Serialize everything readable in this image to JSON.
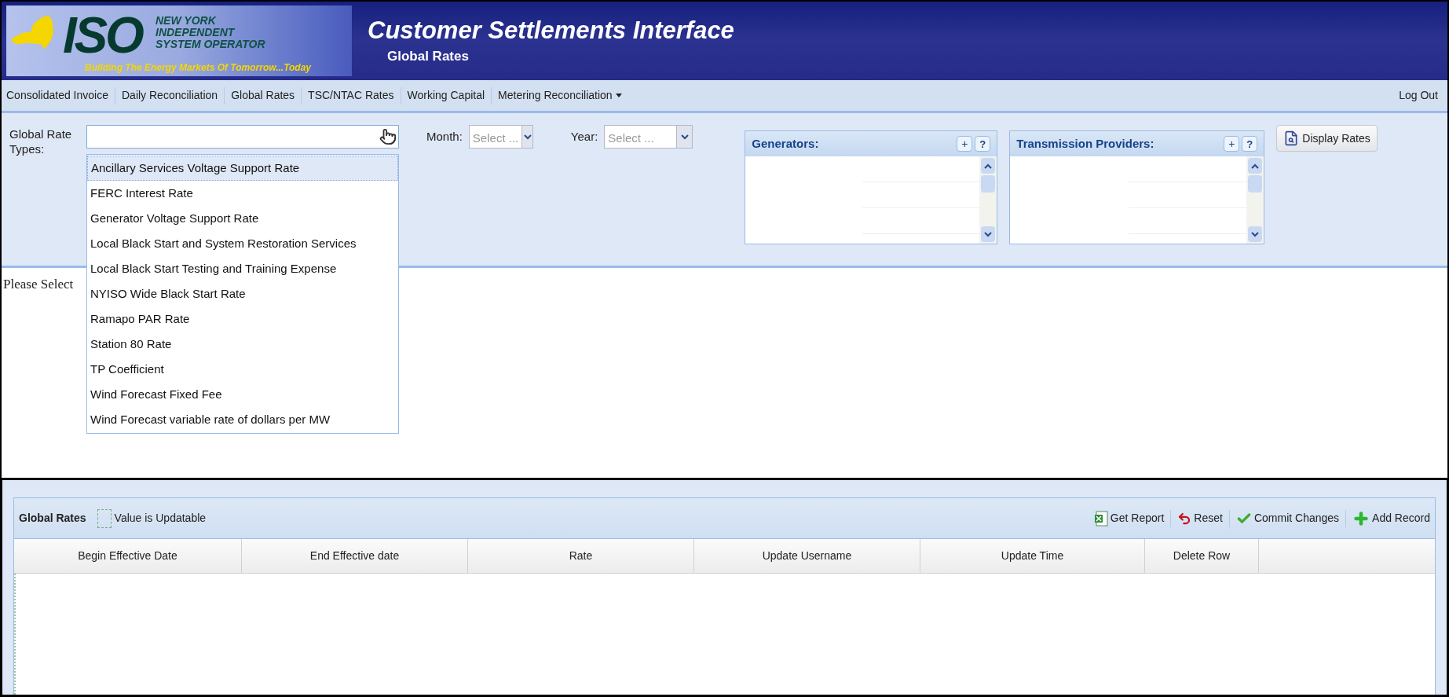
{
  "logo": {
    "mark": "ISO",
    "lines": [
      "NEW YORK",
      "INDEPENDENT",
      "SYSTEM OPERATOR"
    ],
    "tagline": "Building The Energy Markets Of Tomorrow...Today"
  },
  "header": {
    "title": "Customer Settlements Interface",
    "subtitle": "Global Rates"
  },
  "nav": {
    "items": [
      {
        "label": "Consolidated Invoice",
        "has_menu": false
      },
      {
        "label": "Daily Reconciliation",
        "has_menu": false
      },
      {
        "label": "Global Rates",
        "has_menu": false
      },
      {
        "label": "TSC/NTAC Rates",
        "has_menu": false
      },
      {
        "label": "Working Capital",
        "has_menu": false
      },
      {
        "label": "Metering Reconciliation",
        "has_menu": true
      }
    ],
    "logout": "Log Out"
  },
  "filters": {
    "rate_types": {
      "label": "Global Rate Types:",
      "expanded": true,
      "options": [
        {
          "label": "Ancillary Services Voltage Support Rate",
          "selected": true
        },
        {
          "label": "FERC Interest Rate",
          "selected": false
        },
        {
          "label": "Generator Voltage Support Rate",
          "selected": false
        },
        {
          "label": "Local Black Start and System Restoration Services",
          "selected": false
        },
        {
          "label": "Local Black Start Testing and Training Expense",
          "selected": false
        },
        {
          "label": "NYISO Wide Black Start Rate",
          "selected": false
        },
        {
          "label": "Ramapo PAR Rate",
          "selected": false
        },
        {
          "label": "Station 80 Rate",
          "selected": false
        },
        {
          "label": "TP Coefficient",
          "selected": false
        },
        {
          "label": "Wind Forecast Fixed Fee",
          "selected": false
        },
        {
          "label": "Wind Forecast variable rate of dollars per MW",
          "selected": false
        }
      ]
    },
    "month": {
      "label": "Month:",
      "placeholder": "Select ..."
    },
    "year": {
      "label": "Year:",
      "placeholder": "Select ..."
    }
  },
  "lists": [
    {
      "title": "Generators:",
      "add": "+",
      "help": "?"
    },
    {
      "title": "Transmission Providers:",
      "add": "+",
      "help": "?"
    }
  ],
  "display_button": "Display Rates",
  "message": "Please Select",
  "grid": {
    "title": "Global Rates",
    "legend": "Value is Updatable",
    "actions": [
      {
        "label": "Get Report",
        "kind": "excel"
      },
      {
        "label": "Reset",
        "kind": "undo"
      },
      {
        "label": "Commit Changes",
        "kind": "check"
      },
      {
        "label": "Add Record",
        "kind": "add"
      }
    ],
    "columns": [
      "Begin Effective Date",
      "End Effective date",
      "Rate",
      "Update Username",
      "Update Time",
      "Delete Row"
    ]
  }
}
